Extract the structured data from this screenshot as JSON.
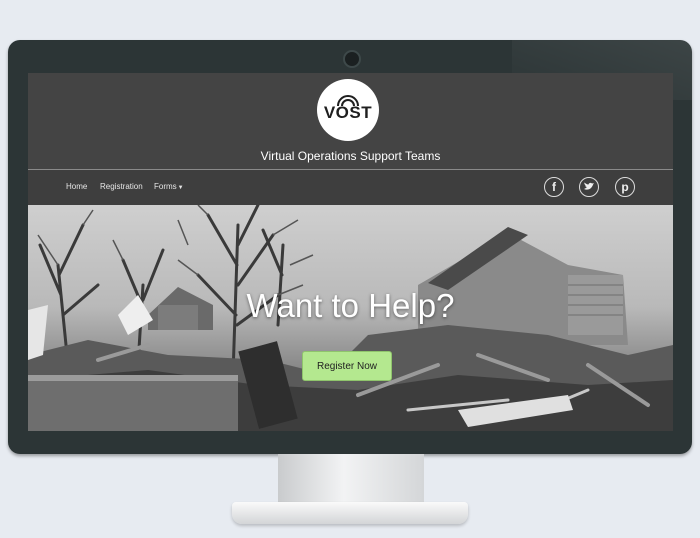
{
  "site": {
    "logo_text": "VOST",
    "tagline": "Virtual Operations Support Teams"
  },
  "nav": {
    "items": [
      {
        "label": "Home"
      },
      {
        "label": "Registration"
      },
      {
        "label": "Forms"
      }
    ],
    "social": [
      {
        "icon": "facebook-icon",
        "glyph": "f"
      },
      {
        "icon": "twitter-icon",
        "glyph": "t"
      },
      {
        "icon": "pinterest-icon",
        "glyph": "p"
      }
    ]
  },
  "hero": {
    "title": "Want to Help?",
    "button_label": "Register Now"
  },
  "colors": {
    "button": "#b4e88f",
    "header": "#444444",
    "monitor": "#2c3536"
  }
}
